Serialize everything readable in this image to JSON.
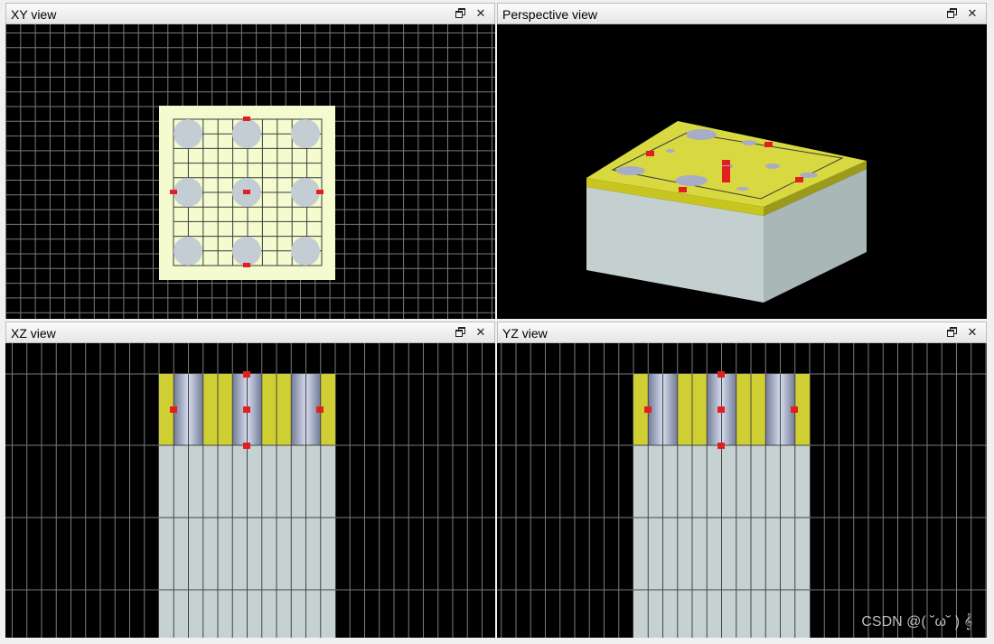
{
  "views": {
    "xy": {
      "title": "XY view"
    },
    "perspective": {
      "title": "Perspective view"
    },
    "xz": {
      "title": "XZ view"
    },
    "yz": {
      "title": "YZ view"
    }
  },
  "window_buttons": {
    "restore_icon": "restore-icon",
    "close_symbol": "✕"
  },
  "watermark": "CSDN @( ˘ω˘ ) 𝄞",
  "colors": {
    "viewport_bg": "#000000",
    "grid": "#7a7a7a",
    "substrate_top": "#f3fbcf",
    "dielectric": "#c6d2d2",
    "yellow_layer": "#c9c930",
    "via": "#b7c2d8",
    "port": "#e21f1f"
  }
}
